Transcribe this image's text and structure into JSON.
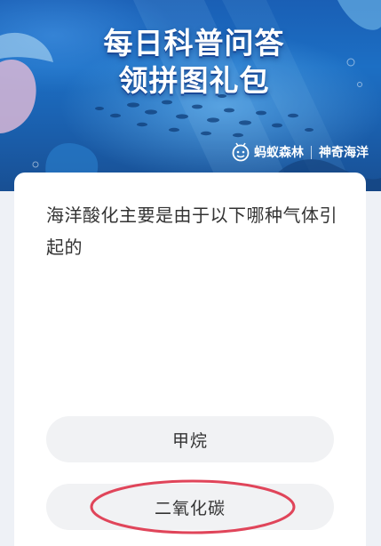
{
  "banner": {
    "title_line1": "每日科普问答",
    "title_line2": "领拼图礼包",
    "brand_name": "蚂蚁森林",
    "brand_sub": "神奇海洋"
  },
  "question": {
    "text": "海洋酸化主要是由于以下哪种气体引起的"
  },
  "options": [
    {
      "label": "甲烷"
    },
    {
      "label": "二氧化碳"
    }
  ],
  "colors": {
    "banner_blue": "#1c6fc4",
    "highlight_ring": "#e0455a",
    "option_bg": "#f1f2f4",
    "text": "#333333"
  }
}
